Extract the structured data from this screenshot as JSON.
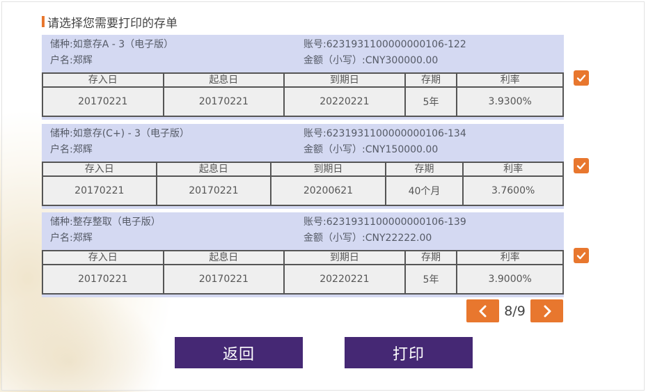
{
  "heading": "请选择您需要打印的存单",
  "columns": [
    "存入日",
    "起息日",
    "到期日",
    "存期",
    "利率"
  ],
  "records": [
    {
      "type": "储种:如意存A - 3（电子版）",
      "account": "账号:6231931100000000106-122",
      "name": "户名:郑辉",
      "amount": "金额（小写）:CNY300000.00",
      "deposit_date": "20170221",
      "value_date": "20170221",
      "maturity_date": "20220221",
      "term": "5年",
      "rate": "3.9300%",
      "checked": true
    },
    {
      "type": "储种:如意存(C+) - 3（电子版）",
      "account": "账号:6231931100000000106-134",
      "name": "户名:郑辉",
      "amount": "金额（小写）:CNY150000.00",
      "deposit_date": "20170221",
      "value_date": "20170221",
      "maturity_date": "20200621",
      "term": "40个月",
      "rate": "3.7600%",
      "checked": true
    },
    {
      "type": "储种:整存整取（电子版）",
      "account": "账号:6231931100000000106-139",
      "name": "户名:郑辉",
      "amount": "金额（小写）:CNY22222.00",
      "deposit_date": "20170221",
      "value_date": "20170221",
      "maturity_date": "20220221",
      "term": "5年",
      "rate": "3.9000%",
      "checked": true
    }
  ],
  "pager": {
    "label": "8/9",
    "prev_icon": "chevron-left-icon",
    "next_icon": "chevron-right-icon"
  },
  "buttons": {
    "back": "返回",
    "print": "打印"
  },
  "colors": {
    "accent": "#e8772e",
    "primary": "#452874",
    "card_bg": "#d4d9f2"
  }
}
